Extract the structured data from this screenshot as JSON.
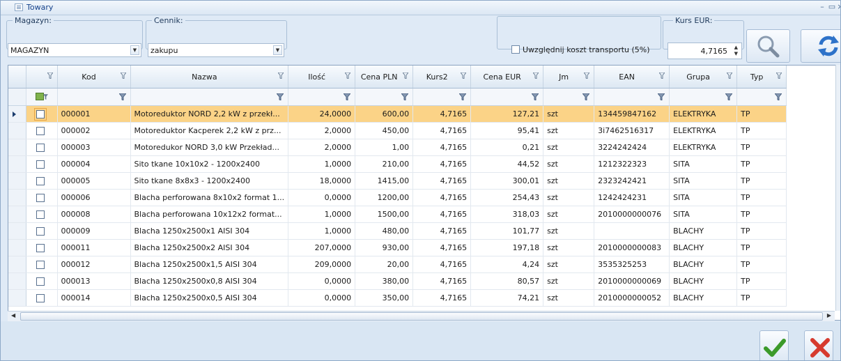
{
  "window": {
    "title": "Towary"
  },
  "filters": {
    "magazyn_label": "Magazyn:",
    "magazyn_value": "MAGAZYN",
    "cennik_label": "Cennik:",
    "cennik_value": "zakupu",
    "transport_label": "Uwzględnij koszt transportu (5%)",
    "transport_checked": false,
    "kurs_label": "Kurs EUR:",
    "kurs_value": "4,7165"
  },
  "table": {
    "columns": [
      "Kod",
      "Nazwa",
      "Ilość",
      "Cena PLN",
      "Kurs2",
      "Cena EUR",
      "Jm",
      "EAN",
      "Grupa",
      "Typ"
    ],
    "selected_row_index": 0,
    "rows": [
      [
        "000001",
        "Motoreduktor NORD 2,2 kW z przekł...",
        "24,0000",
        "600,00",
        "4,7165",
        "127,21",
        "szt",
        "134459847162",
        "ELEKTRYKA",
        "TP"
      ],
      [
        "000002",
        "Motoreduktor Kacperek 2,2 kW z prz...",
        "2,0000",
        "450,00",
        "4,7165",
        "95,41",
        "szt",
        "3i7462516317",
        "ELEKTRYKA",
        "TP"
      ],
      [
        "000003",
        "Motoredukor NORD 3,0 kW Przekład...",
        "2,0000",
        "1,00",
        "4,7165",
        "0,21",
        "szt",
        "3224242424",
        "ELEKTRYKA",
        "TP"
      ],
      [
        "000004",
        "Sito tkane 10x10x2 - 1200x2400",
        "1,0000",
        "210,00",
        "4,7165",
        "44,52",
        "szt",
        "1212322323",
        "SITA",
        "TP"
      ],
      [
        "000005",
        "Sito tkane 8x8x3 - 1200x2400",
        "18,0000",
        "1415,00",
        "4,7165",
        "300,01",
        "szt",
        "2323242421",
        "SITA",
        "TP"
      ],
      [
        "000006",
        "Blacha perforowana 8x10x2 format 1...",
        "0,0000",
        "1200,00",
        "4,7165",
        "254,43",
        "szt",
        "1242424231",
        "SITA",
        "TP"
      ],
      [
        "000008",
        "Blacha perforowana 10x12x2 format...",
        "1,0000",
        "1500,00",
        "4,7165",
        "318,03",
        "szt",
        "2010000000076",
        "SITA",
        "TP"
      ],
      [
        "000009",
        "Blacha 1250x2500x1 AISI 304",
        "1,0000",
        "480,00",
        "4,7165",
        "101,77",
        "szt",
        "",
        "BLACHY",
        "TP"
      ],
      [
        "000011",
        "Blacha 1250x2500x2 AISI 304",
        "207,0000",
        "930,00",
        "4,7165",
        "197,18",
        "szt",
        "2010000000083",
        "BLACHY",
        "TP"
      ],
      [
        "000012",
        "Blacha 1250x2500x1,5 AISI 304",
        "209,0000",
        "20,00",
        "4,7165",
        "4,24",
        "szt",
        "3535325253",
        "BLACHY",
        "TP"
      ],
      [
        "000013",
        "Blacha 1250x2500x0,8 AISI 304",
        "0,0000",
        "380,00",
        "4,7165",
        "80,57",
        "szt",
        "2010000000069",
        "BLACHY",
        "TP"
      ],
      [
        "000014",
        "Blacha 1250x2500x0,5 AISI 304",
        "0,0000",
        "350,00",
        "4,7165",
        "74,21",
        "szt",
        "2010000000052",
        "BLACHY",
        "TP"
      ]
    ]
  },
  "colors": {
    "selected_row": "#fbd387",
    "header": "#dde8f3",
    "accent": "#15428b"
  },
  "icons": {
    "search": "search-icon",
    "refresh": "refresh-icon",
    "ok": "checkmark-icon",
    "cancel": "close-icon"
  }
}
